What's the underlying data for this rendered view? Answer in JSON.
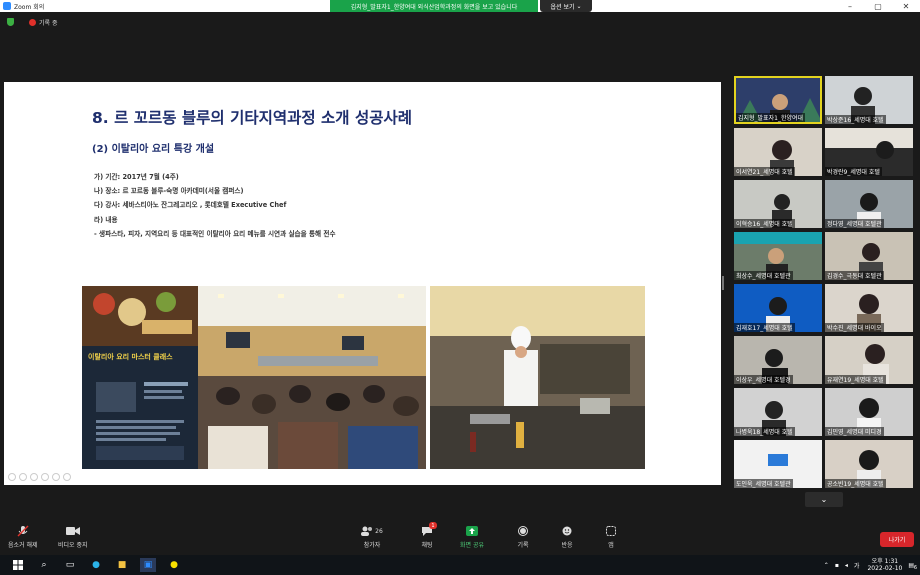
{
  "window": {
    "title": "Zoom 회의",
    "controls": [
      "minimize",
      "maximize",
      "close"
    ]
  },
  "share_banner": "김지형_발표자1_한양여대 외식산업학과정의 화면을 보고 있습니다",
  "view_options": "옵션 보기",
  "recording": {
    "label": "기록 중"
  },
  "slide": {
    "title": "8. 르 꼬르동 블루의 기타지역과정 소개 성공사례",
    "subtitle": "(2) 이탈리아 요리 특강 개설",
    "bullets": [
      "가) 기간: 2017년 7월 (4주)",
      "나) 장소: 르 꼬르동 블루-숙명 아카데미(서울 캠퍼스)",
      "다) 강사: 세바스티아노 잔그레고리오 , 롯데호텔  Executive Chef",
      "라) 내용",
      "- 생파스타, 피자, 지역요리 등 대표적인 이탈리아 요리 메뉴를 시연과 실습을 통해 전수"
    ],
    "poster_text": "이탈리아 요리 마스터 클래스"
  },
  "participants": [
    {
      "name": "김지형_발표자1_한양여대",
      "bg": "#3a4a6a",
      "active": true
    },
    {
      "name": "박상준16_세명대 호텔",
      "bg": "#cfd3d6"
    },
    {
      "name": "이서연21_세명대 호텔",
      "bg": "#d8d2c8"
    },
    {
      "name": "박경란9_세명대 호텔",
      "bg": "#2b2b2b"
    },
    {
      "name": "이혁승16_세명대 호텔",
      "bg": "#c8c9c4"
    },
    {
      "name": "정다영_세명대 호텔관",
      "bg": "#9aa3a8"
    },
    {
      "name": "최상수_세명대 호텔관",
      "bg": "#6c7c6a"
    },
    {
      "name": "김경수_극동대 호텔관",
      "bg": "#c9c2b5"
    },
    {
      "name": "김재호17_세명대 호텔",
      "bg": "#0f5cc2"
    },
    {
      "name": "박수진_세명대 바이오",
      "bg": "#dbd5cc"
    },
    {
      "name": "이상우_세명대 호텔경",
      "bg": "#b9b6ae"
    },
    {
      "name": "유재연19_세명대 호텔",
      "bg": "#d6d0c6"
    },
    {
      "name": "나병욱18_세명대 호텔",
      "bg": "#d2d2d2"
    },
    {
      "name": "김민영_세명대 미디경",
      "bg": "#cfcfcf"
    },
    {
      "name": "도인욱_세명대 호텔관",
      "bg": "#f2f2f2"
    },
    {
      "name": "공소빈19_세명대 호텔",
      "bg": "#d8d0c6"
    }
  ],
  "toolbar": {
    "mute": "음소거 해제",
    "video": "비디오 중지",
    "participants": "참가자",
    "participants_count": "26",
    "chat": "채팅",
    "chat_badge": "1",
    "share": "화면 공유",
    "record": "기록",
    "reactions": "반응",
    "apps": "앱",
    "leave": "나가기"
  },
  "taskbar": {
    "ime": "가",
    "time": "오후 1:31",
    "date": "2022-02-10",
    "notifications": "6"
  },
  "colors": {
    "share_green": "#1aa34a",
    "leave_red": "#d7262b",
    "active_speaker": "#e3d31f",
    "slide_title": "#1f2f6e"
  }
}
